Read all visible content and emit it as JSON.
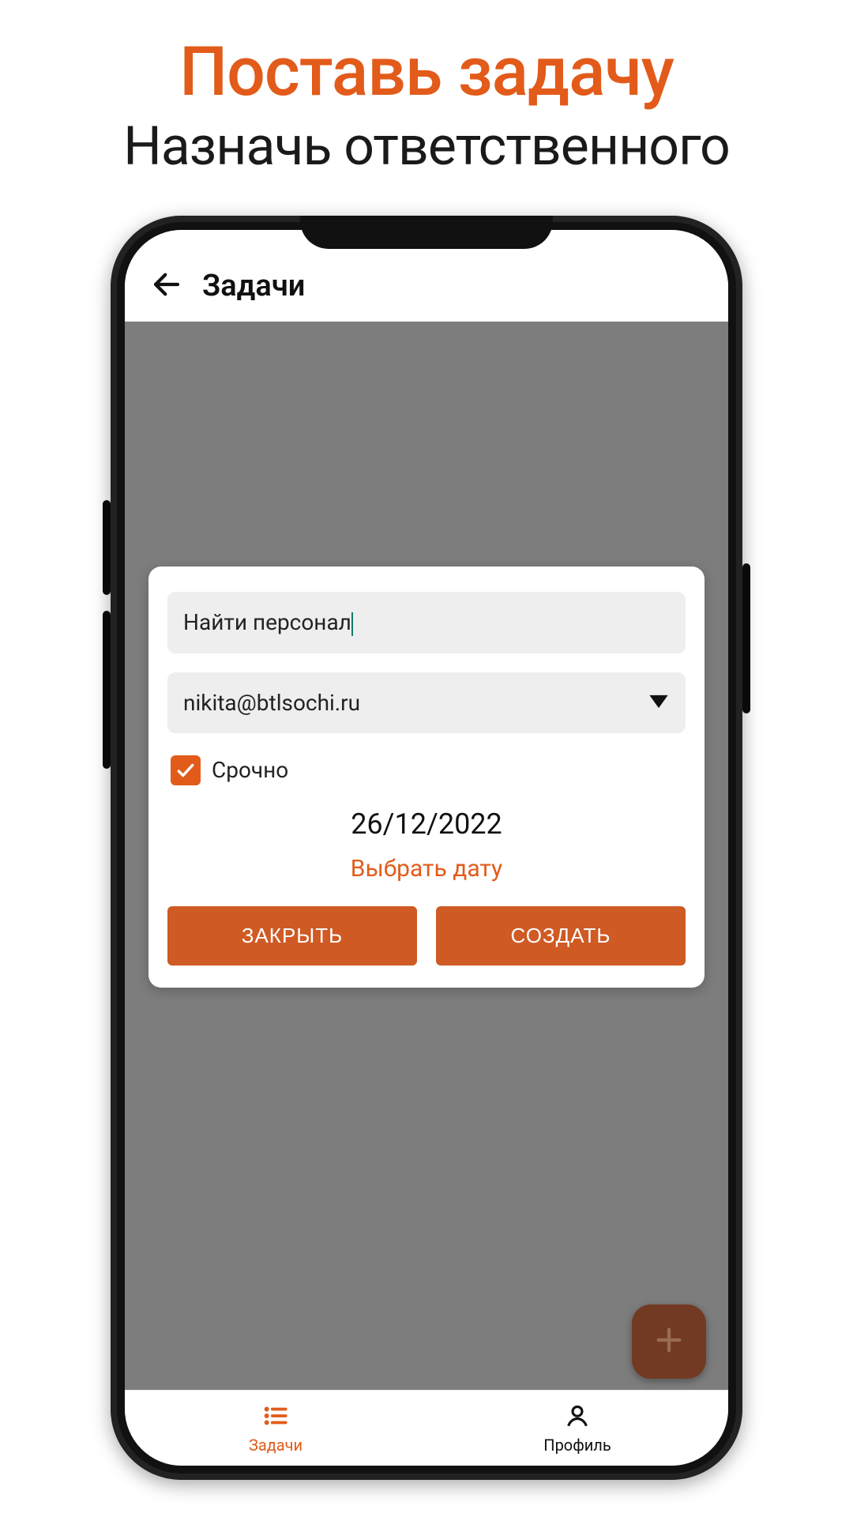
{
  "promo": {
    "title": "Поставь задачу",
    "subtitle": "Назначь ответственного"
  },
  "appbar": {
    "title": "Задачи"
  },
  "dialog": {
    "task_name_value": "Найти персонал",
    "assignee_value": "nikita@btlsochi.ru",
    "urgent_label": "Срочно",
    "urgent_checked": true,
    "date_value": "26/12/2022",
    "pick_date_label": "Выбрать дату",
    "close_label": "ЗАКРЫТЬ",
    "create_label": "СОЗДАТЬ"
  },
  "nav": {
    "tasks_label": "Задачи",
    "profile_label": "Профиль"
  },
  "colors": {
    "accent": "#e25b1a"
  }
}
